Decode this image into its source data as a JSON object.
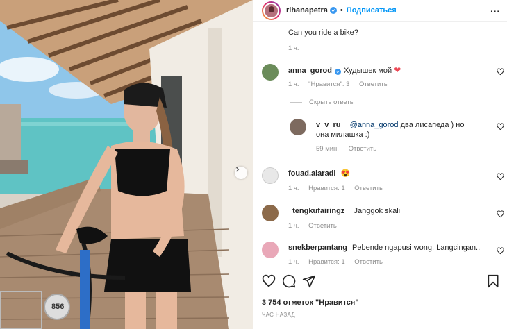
{
  "post": {
    "author": "rihanapetra",
    "dot": "•",
    "follow_label": "Подписаться",
    "more_label": "···",
    "bike_number": "856"
  },
  "caption": {
    "text": "Can you ride a bike?",
    "time": "1 ч."
  },
  "comments": [
    {
      "user": "anna_gorod",
      "text": "Худышек мой",
      "emoji": "❤",
      "time": "1 ч.",
      "likes": "\"Нравится\": 3",
      "reply_label": "Ответить",
      "avatar_color": "#6b8c5a",
      "hide_replies_label": "Скрыть ответы"
    },
    {
      "user": "v_v_ru_",
      "mention": "@anna_gorod",
      "text": "два лисапеда ) но она милашка :)",
      "time": "59 мин.",
      "reply_label": "Ответить",
      "avatar_color": "#7d6a5f"
    },
    {
      "user": "fouad.alaradi",
      "emoji": "😍",
      "time": "1 ч.",
      "likes": "Нравится: 1",
      "reply_label": "Ответить",
      "avatar_color": "#e8e8e8"
    },
    {
      "user": "_tengkufairingz_",
      "text": "Janggok skali",
      "time": "1 ч.",
      "reply_label": "Ответить",
      "avatar_color": "#8c6a4a"
    },
    {
      "user": "snekberpantang",
      "text": "Pebende ngapusi wong. Langcingan..",
      "time": "1 ч.",
      "likes": "Нравится: 1",
      "reply_label": "Ответить",
      "avatar_color": "#e9a8b8"
    }
  ],
  "footer": {
    "likes_count": "3 754 отметок \"Нравится\"",
    "time_ago": "ЧАС НАЗАД"
  },
  "icons": {
    "like": "heart-icon",
    "comment": "comment-icon",
    "share": "paper-plane-icon",
    "save": "bookmark-icon",
    "verified": "verified-badge-icon",
    "next": "chevron-right-icon"
  },
  "colors": {
    "accent": "#0095f6",
    "verified": "#3897f0",
    "heart_red": "#ed4956",
    "muted": "#8e8e8e"
  }
}
